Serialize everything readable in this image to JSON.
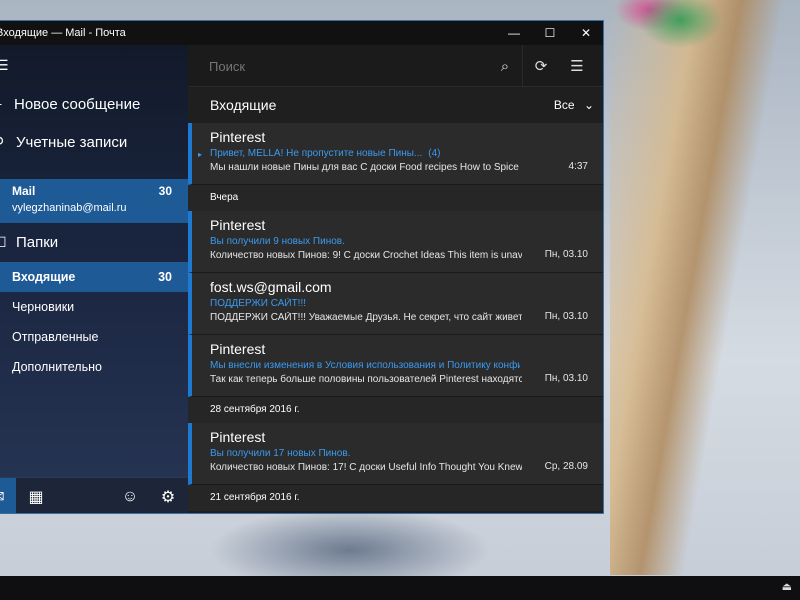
{
  "window": {
    "title": "Входящие — Mail - Почта",
    "controls": {
      "minimize": "—",
      "maximize": "☐",
      "close": "✕"
    }
  },
  "sidebar": {
    "hamburger_icon": "menu-icon",
    "new_message": "Новое сообщение",
    "accounts": "Учетные записи",
    "account": {
      "name": "Mail",
      "count": "30",
      "email": "vylegzhaninab@mail.ru"
    },
    "folders_label": "Папки",
    "folders": [
      {
        "label": "Входящие",
        "count": "30",
        "active": true
      },
      {
        "label": "Черновики",
        "count": ""
      },
      {
        "label": "Отправленные",
        "count": ""
      },
      {
        "label": "Дополнительно",
        "count": ""
      }
    ],
    "bottom_icons": [
      "mail-icon",
      "calendar-icon",
      "smiley-icon",
      "gear-icon"
    ]
  },
  "main": {
    "search_placeholder": "Поиск",
    "inbox_title": "Входящие",
    "filter_label": "Все",
    "icons": [
      "search-icon",
      "sync-icon",
      "select-icon"
    ]
  },
  "messages": {
    "m1": {
      "sender": "Pinterest",
      "subject": "Привет, MELLA! Не пропустите новые Пины...",
      "count": "(4)",
      "preview": "Мы нашли новые Пины для вас С доски Food recipes How to Spice Up Yc",
      "time": "4:37"
    },
    "g1": "Вчера",
    "m2": {
      "sender": "Pinterest",
      "subject": "Вы получили 9 новых Пинов.",
      "preview": "Количество новых Пинов: 9! С доски Crochet Ideas This item is unav",
      "time": "Пн, 03.10"
    },
    "m3": {
      "sender": "fost.ws@gmail.com",
      "subject": "ПОДДЕРЖИ САЙТ!!!",
      "preview": "ПОДДЕРЖИ САЙТ!!! Уважаемые Друзья. Не секрет, что сайт живет",
      "time": "Пн, 03.10"
    },
    "m4": {
      "sender": "Pinterest",
      "subject": "Мы внесли изменения в Условия использования и Политику конфи",
      "preview": "Так как теперь больше половины пользователей Pinterest находятс",
      "time": "Пн, 03.10"
    },
    "g2": "28 сентября 2016 г.",
    "m5": {
      "sender": "Pinterest",
      "subject": "Вы получили 17 новых Пинов.",
      "preview": "Количество новых Пинов: 17! С доски Useful Info Thought You Knew",
      "time": "Ср, 28.09"
    },
    "g3": "21 сентября 2016 г."
  },
  "colors": {
    "accent": "#1e5a96",
    "link_blue": "#3b9af0",
    "unread_bar": "#1e7ad0"
  }
}
